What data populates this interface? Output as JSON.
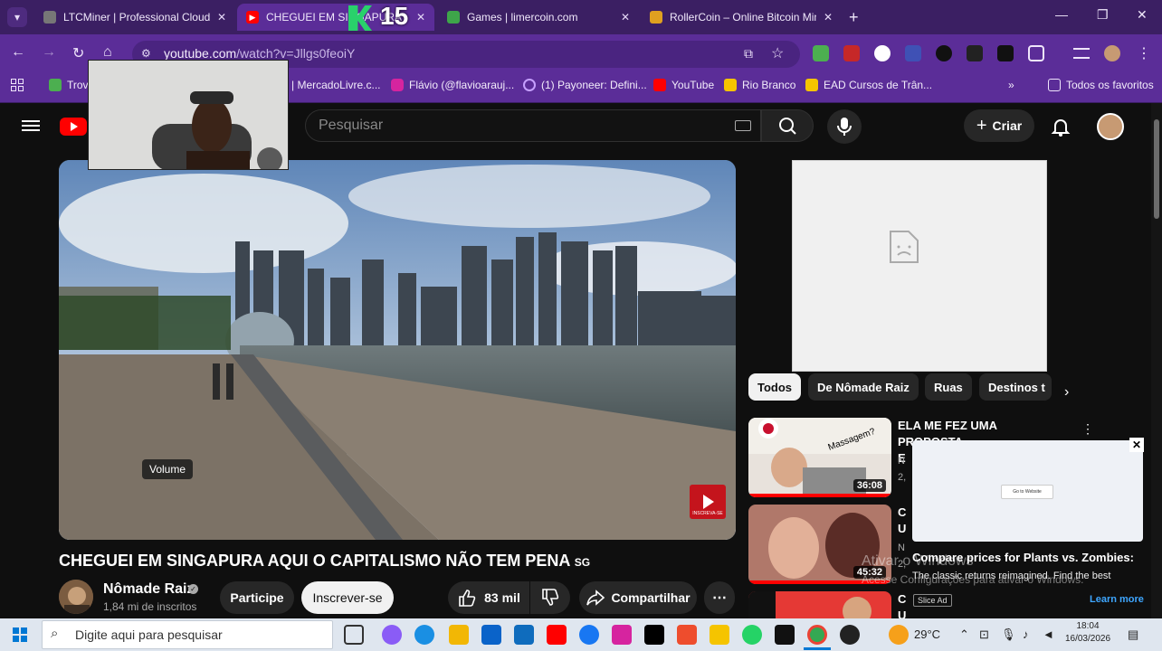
{
  "browser": {
    "tabs": [
      {
        "title": "LTCMiner | Professional Cloud M",
        "active": false
      },
      {
        "title": "CHEGUEI EM SINGAPURA",
        "active": true
      },
      {
        "title": "Games | limercoin.com",
        "active": false
      },
      {
        "title": "RollerCoin – Online Bitcoin Mini",
        "active": false
      }
    ],
    "overlay_number": "15",
    "url_host": "youtube.com",
    "url_path": "/watch?v=Jllgs0feoiY",
    "bookmarks": [
      {
        "label": "Trov"
      },
      {
        "label": "| MercadoLivre.c..."
      },
      {
        "label": "Flávio (@flavioarauj..."
      },
      {
        "label": "(1) Payoneer: Defini..."
      },
      {
        "label": "YouTube"
      },
      {
        "label": "Rio Branco"
      },
      {
        "label": "EAD Cursos de Trân..."
      }
    ],
    "all_bookmarks": "Todos os favoritos"
  },
  "youtube": {
    "search_placeholder": "Pesquisar",
    "create_label": "Criar",
    "volume_tooltip": "Volume",
    "subscribe_badge": "INSCREVA-SE",
    "video_title": "CHEGUEI EM SINGAPURA AQUI O CAPITALISMO NÃO TEM PENA",
    "video_title_flag": "SG",
    "channel_name": "Nômade Raiz",
    "channel_subs": "1,84 mi de inscritos",
    "join_label": "Participe",
    "subscribe_label": "Inscrever-se",
    "likes": "83 mil",
    "share_label": "Compartilhar",
    "chips": [
      "Todos",
      "De Nômade Raiz",
      "Ruas",
      "Destinos t"
    ],
    "recommendations": [
      {
        "title": "ELA ME FEZ UMA PROPOSTA",
        "title_line2": "E",
        "meta1": "N",
        "meta2": "2,",
        "duration": "36:08"
      },
      {
        "title": "C",
        "title_line2": "U",
        "meta1": "N",
        "meta2": "2,",
        "duration": "45:32"
      },
      {
        "title": "C",
        "title_line2": "U",
        "duration": ""
      }
    ],
    "thumb_text": "Massagem?",
    "ad": {
      "button": "Go to Website",
      "headline": "Compare prices for Plants vs. Zombies:",
      "description": "The classic returns reimagined. Find the best",
      "tag": "Slice Ad",
      "learn_more": "Learn more"
    },
    "windows_watermark_1": "Ativar o Windows",
    "windows_watermark_2": "Acesse Configurações para ativar o Windows."
  },
  "taskbar": {
    "search_placeholder": "Digite aqui para pesquisar",
    "temperature": "29°C",
    "time": "18:04",
    "date": "16/03/2026"
  }
}
